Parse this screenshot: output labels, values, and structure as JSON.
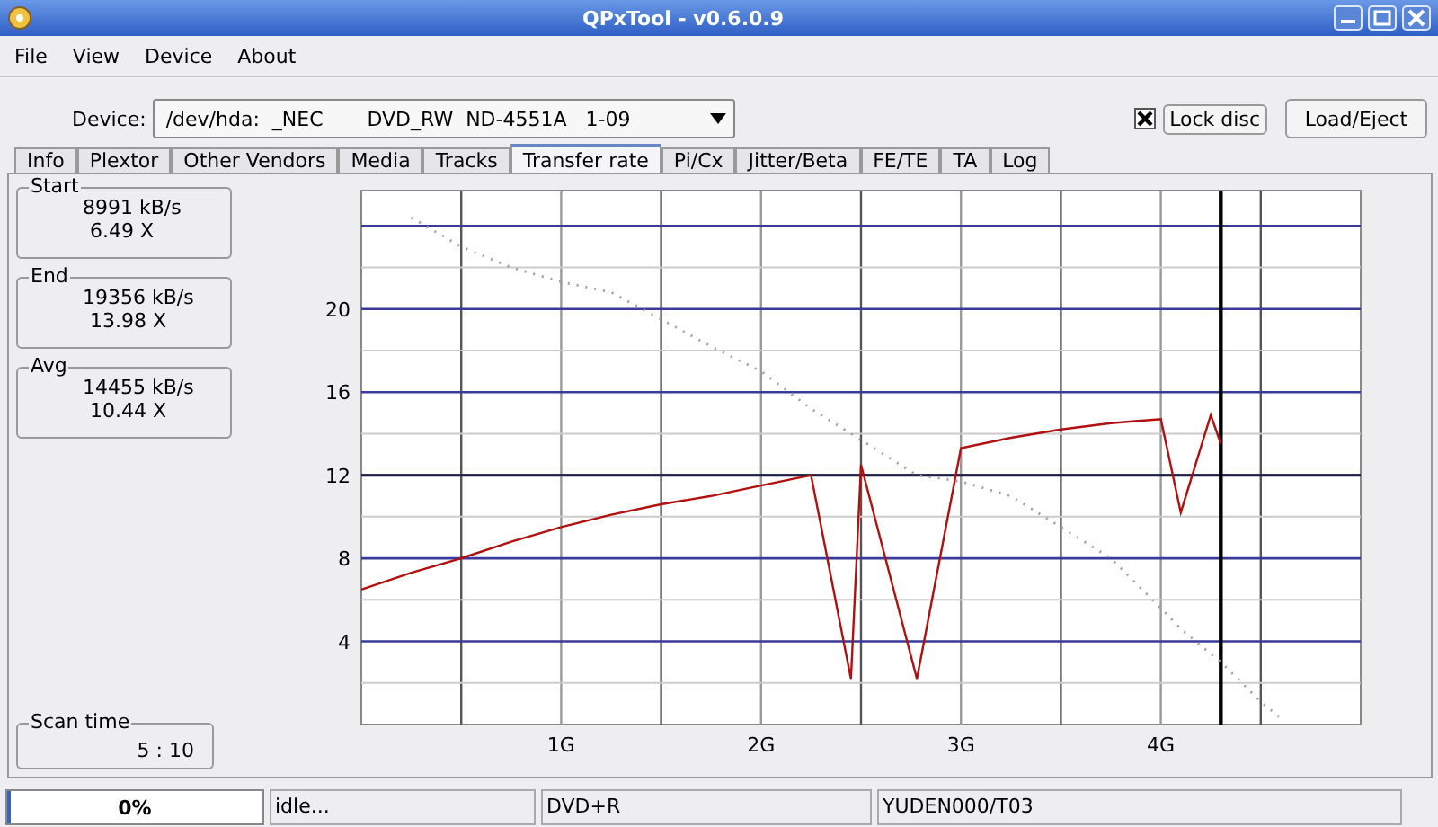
{
  "window": {
    "title": "QPxTool - v0.6.0.9"
  },
  "menu": [
    "File",
    "View",
    "Device",
    "About"
  ],
  "device": {
    "label": "Device:",
    "value": "/dev/hda:  _NEC       DVD_RW  ND-4551A   1-09"
  },
  "lock_disc": {
    "label": "Lock disc",
    "checked": true
  },
  "load_eject": "Load/Eject",
  "tabs": [
    {
      "label": "Info",
      "selected": false
    },
    {
      "label": "Plextor",
      "selected": false
    },
    {
      "label": "Other Vendors",
      "selected": false
    },
    {
      "label": "Media",
      "selected": false
    },
    {
      "label": "Tracks",
      "selected": false
    },
    {
      "label": "Transfer rate",
      "selected": true
    },
    {
      "label": "Pi/Cx",
      "selected": false
    },
    {
      "label": "Jitter/Beta",
      "selected": false
    },
    {
      "label": "FE/TE",
      "selected": false
    },
    {
      "label": "TA",
      "selected": false
    },
    {
      "label": "Log",
      "selected": false
    }
  ],
  "stats": [
    {
      "title": "Start",
      "speed": "8991 kB/s",
      "factor": "6.49 X"
    },
    {
      "title": "End",
      "speed": "19356 kB/s",
      "factor": "13.98 X"
    },
    {
      "title": "Avg",
      "speed": "14455 kB/s",
      "factor": "10.44 X"
    }
  ],
  "scan_time": {
    "title": "Scan time",
    "value": "5 : 10"
  },
  "chart_data": {
    "type": "line",
    "xlim": [
      0,
      5
    ],
    "ylim": [
      0,
      25.7
    ],
    "xticks": [
      {
        "value": 1,
        "label": "1G"
      },
      {
        "value": 2,
        "label": "2G"
      },
      {
        "value": 3,
        "label": "3G"
      },
      {
        "value": 4,
        "label": "4G"
      }
    ],
    "yticks": [
      4,
      8,
      12,
      16,
      20
    ],
    "x": [
      0,
      0.25,
      0.5,
      0.75,
      1,
      1.25,
      1.5,
      1.75,
      2,
      2.25,
      2.45,
      2.5,
      2.78,
      3,
      3.25,
      3.5,
      3.75,
      4,
      4.1,
      4.25,
      4.3,
      4.5,
      4.6
    ],
    "series": [
      {
        "color": "#b01010",
        "line_style": "solid",
        "values": [
          6.5,
          7.3,
          8,
          8.8,
          9.5,
          10.1,
          10.6,
          11.0,
          11.5,
          12,
          2.2,
          12.5,
          2.2,
          13.3,
          13.8,
          14.2,
          14.5,
          14.7,
          10.2,
          14.9,
          13.5,
          null,
          null
        ]
      },
      {
        "color": "#a0a0a0",
        "line_style": "dotted",
        "values": [
          null,
          24.4,
          23,
          22,
          21.3,
          20.8,
          19.5,
          18.2,
          17,
          15.2,
          14,
          13.7,
          12,
          11.7,
          11,
          9.5,
          8,
          5.6,
          4.6,
          3.4,
          3,
          1.1,
          0.3
        ]
      }
    ],
    "grid": true,
    "ref_lines": [
      {
        "axis": "y",
        "value": 12,
        "color": "#202040"
      },
      {
        "axis": "x",
        "value": 4.3,
        "color": "#000000"
      }
    ]
  },
  "status": {
    "progress": {
      "level": 0.0,
      "text": "0%"
    },
    "state": "idle...",
    "media": "DVD+R",
    "media_id": "YUDEN000/T03"
  }
}
